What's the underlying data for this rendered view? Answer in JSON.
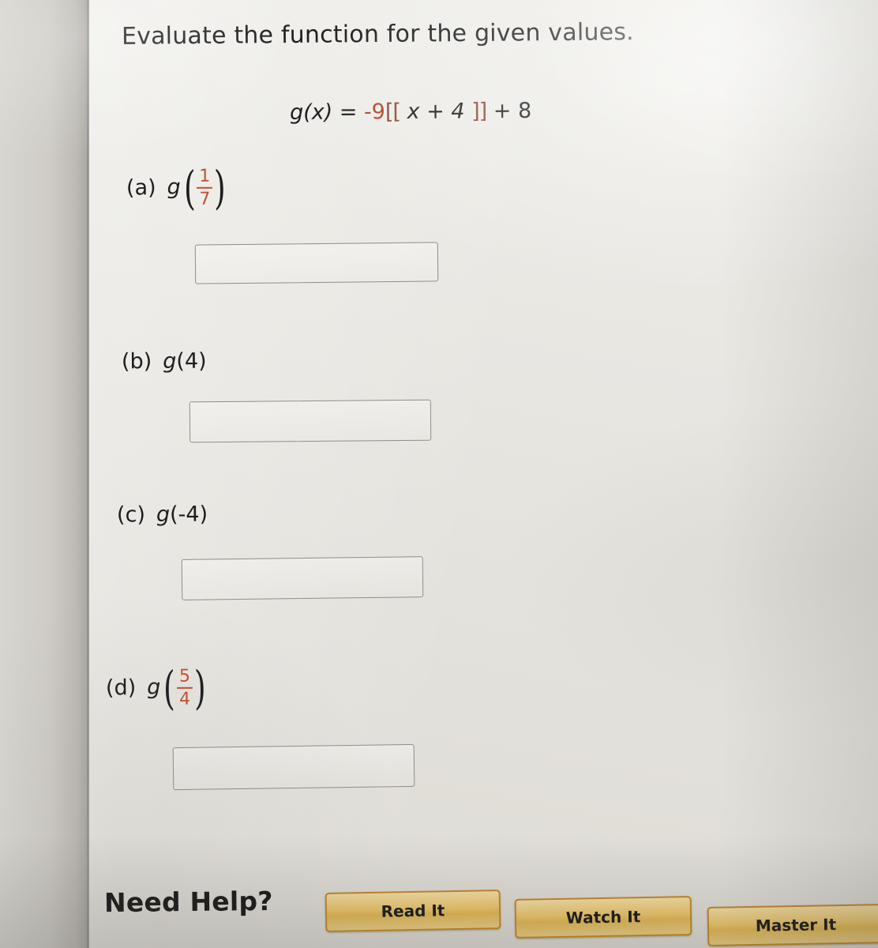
{
  "question": {
    "prompt": "Evaluate the function for the given values.",
    "equation": {
      "lhs": "g(x)",
      "equals": "=",
      "coefficient": "-9",
      "bracket_open": "[[",
      "inner": "x + 4",
      "bracket_close": "]]",
      "plus": "+ 8",
      "full_text": "g(x) = -9[[x + 4]] + 8"
    },
    "parts": [
      {
        "label": "(a)",
        "function": "g",
        "argument_type": "fraction",
        "numerator": "1",
        "denominator": "7",
        "argument_text": "1/7",
        "answer_value": "",
        "answer_placeholder": ""
      },
      {
        "label": "(b)",
        "function": "g",
        "argument_type": "plain",
        "argument_text": "(4)",
        "answer_value": "",
        "answer_placeholder": ""
      },
      {
        "label": "(c)",
        "function": "g",
        "argument_type": "plain",
        "argument_text": "(-4)",
        "answer_value": "",
        "answer_placeholder": ""
      },
      {
        "label": "(d)",
        "function": "g",
        "argument_type": "fraction",
        "numerator": "5",
        "denominator": "4",
        "argument_text": "5/4",
        "answer_value": "",
        "answer_placeholder": ""
      }
    ]
  },
  "help": {
    "title": "Need Help?",
    "buttons": [
      {
        "label": "Read It"
      },
      {
        "label": "Watch It"
      },
      {
        "label": "Master It"
      }
    ]
  },
  "colors": {
    "page_background": "#e8e6e1",
    "text": "#1d1d1f",
    "accent_red": "#b2462c",
    "fraction_red": "#c1502e",
    "button_border": "#c98a20",
    "button_fill": "#eec86a",
    "input_border": "#8f8d86"
  }
}
